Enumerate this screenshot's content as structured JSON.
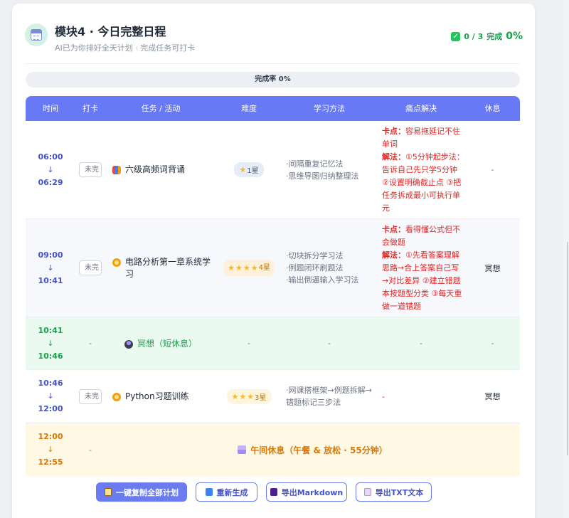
{
  "header": {
    "title": "模块4 · 今日完整日程",
    "subtitle": "AI已为你排好全天计划 · 完成任务可打卡",
    "status_count": "0 / 3",
    "status_label": "完成",
    "status_percent": "0%"
  },
  "progress": {
    "label": "完成率 0%",
    "fraction": 0
  },
  "table": {
    "columns": [
      "时间",
      "打卡",
      "任务 / 活动",
      "难度",
      "学习方法",
      "痛点解决",
      "休息"
    ],
    "rows": [
      {
        "start": "06:00",
        "arrow": "↓",
        "end": "06:29",
        "check": "未完",
        "task": "六级高频词背诵",
        "task_icon": "book-icon",
        "difficulty": "1星",
        "stars": 1,
        "methods": [
          "·间隔重复记忆法",
          "·思维导图归纳整理法"
        ],
        "pain_key_label": "卡点：",
        "pain_key": "容易拖延记不住单词",
        "pain_sol_label": "解法：",
        "pain_sol": "①5分钟起步法：告诉自己先只学5分钟 ②设置明确截止点 ③把任务拆成最小可执行单元",
        "rest": "-"
      },
      {
        "start": "09:00",
        "arrow": "↓",
        "end": "10:41",
        "check": "未完",
        "task": "电路分析第一章系统学习",
        "task_icon": "gear-icon",
        "difficulty": "4星",
        "stars": 4,
        "methods": [
          "·切块拆分学习法",
          "·例题闭环刷题法",
          "·输出倒逼输入学习法"
        ],
        "pain_key_label": "卡点：",
        "pain_key": "看得懂公式但不会做题",
        "pain_sol_label": "解法：",
        "pain_sol": "①先看答案理解思路→合上答案自己写→对比差异 ②建立错题本按题型分类 ③每天重做一道错题",
        "rest": "冥想"
      },
      {
        "start": "10:41",
        "arrow": "↓",
        "end": "10:46",
        "check": "-",
        "task": "冥想（短休息）",
        "task_icon": "meditate-icon",
        "difficulty": "-",
        "method_dash": "-",
        "pain_dash": "-",
        "rest": "-"
      },
      {
        "start": "10:46",
        "arrow": "↓",
        "end": "12:00",
        "check": "未完",
        "task": "Python习题训练",
        "task_icon": "gear-icon",
        "difficulty": "3星",
        "stars": 3,
        "methods": [
          "·网课搭框架→例题拆解→错题标记三步法"
        ],
        "pain_dash": "-",
        "rest": "冥想"
      },
      {
        "start": "12:00",
        "arrow": "↓",
        "end": "12:55",
        "check": "-",
        "task": "午间休息（午餐 & 放松 · 55分钟）",
        "task_icon": "meal-icon"
      }
    ]
  },
  "actions": {
    "copy": "一键复制全部计划",
    "regenerate": "重新生成",
    "export_md": "导出Markdown",
    "export_txt": "导出TXT文本"
  },
  "colors": {
    "accent": "#6a7cf0",
    "success": "#16a34a",
    "danger": "#dc2626",
    "warning": "#d97706"
  }
}
